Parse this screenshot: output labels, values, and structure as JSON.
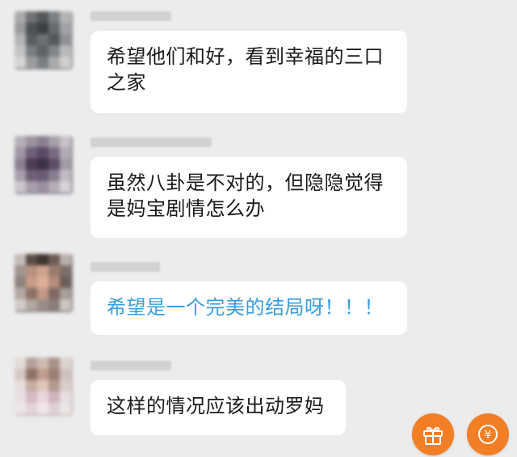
{
  "messages": [
    {
      "avatar_tone": "dark-gray",
      "name_blurred": true,
      "text": "希望他们和好，看到幸福的三口之家",
      "style": "normal"
    },
    {
      "avatar_tone": "purple-gray",
      "name_blurred": true,
      "text": "虽然八卦是不对的，但隐隐觉得是妈宝剧情怎么办",
      "style": "normal"
    },
    {
      "avatar_tone": "skin-dark",
      "name_blurred": true,
      "text": "希望是一个完美的结局呀！！！",
      "style": "link"
    },
    {
      "avatar_tone": "beige-pink",
      "name_blurred": true,
      "text": "这样的情况应该出动罗妈",
      "style": "normal"
    }
  ],
  "buttons": {
    "gift": {
      "icon": "gift-icon",
      "color": "#f27e25"
    },
    "reward": {
      "icon": "yen-icon",
      "color": "#f27e25",
      "symbol": "¥"
    }
  },
  "colors": {
    "background": "#ececec",
    "bubble": "#ffffff",
    "text": "#1a1a1a",
    "link_text": "#3a9ddf",
    "accent": "#f27e25"
  }
}
